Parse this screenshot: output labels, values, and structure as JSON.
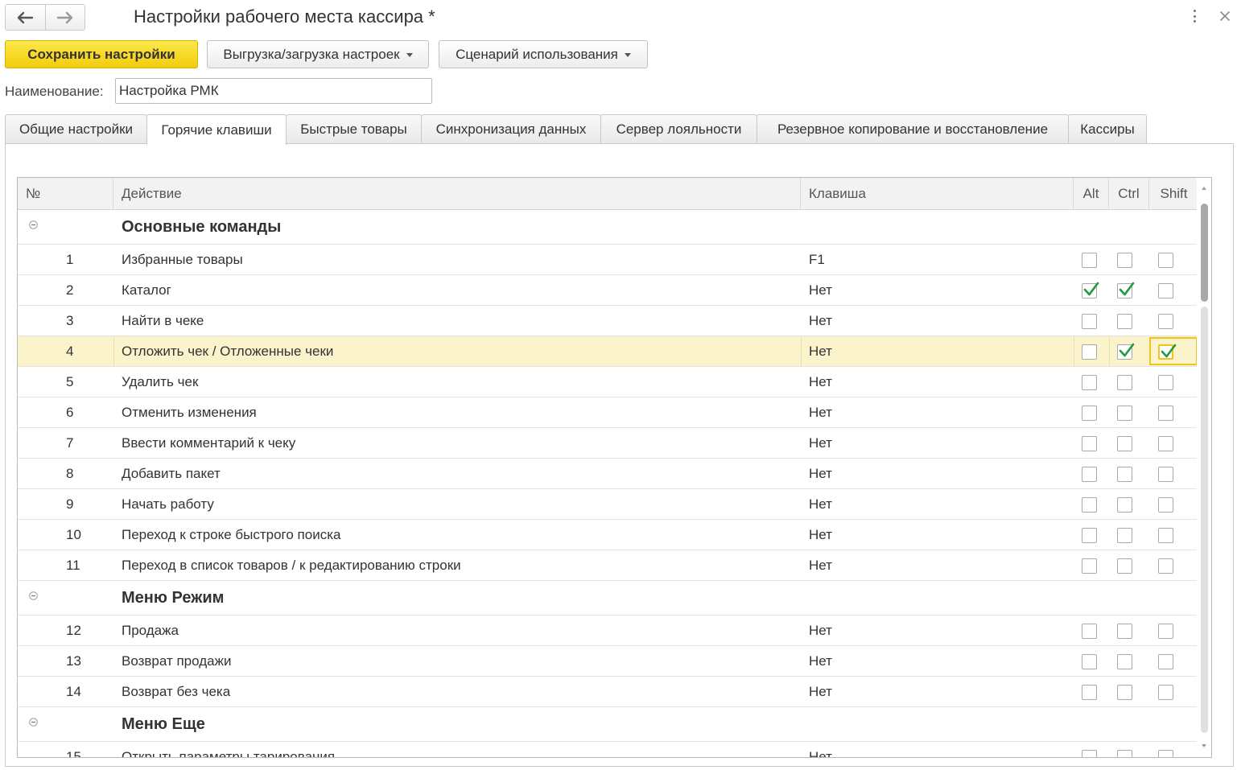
{
  "window": {
    "title": "Настройки рабочего места кассира *"
  },
  "toolbar": {
    "save_label": "Сохранить настройки",
    "export_label": "Выгрузка/загрузка настроек",
    "scenario_label": "Сценарий использования"
  },
  "form": {
    "name_label": "Наименование:",
    "name_value": "Настройка РМК"
  },
  "tabs": [
    {
      "label": "Общие настройки",
      "active": false
    },
    {
      "label": "Горячие клавиши",
      "active": true
    },
    {
      "label": "Быстрые товары",
      "active": false
    },
    {
      "label": "Синхронизация данных",
      "active": false
    },
    {
      "label": "Сервер лояльности",
      "active": false
    },
    {
      "label": "Резервное копирование и восстановление",
      "active": false
    },
    {
      "label": "Кассиры",
      "active": false
    }
  ],
  "table": {
    "columns": {
      "num": "№",
      "action": "Действие",
      "key": "Клавиша",
      "alt": "Alt",
      "ctrl": "Ctrl",
      "shift": "Shift"
    },
    "rows": [
      {
        "type": "group",
        "title": "Основные команды"
      },
      {
        "type": "item",
        "num": "1",
        "action": "Избранные товары",
        "key": "F1",
        "alt": false,
        "ctrl": false,
        "shift": false
      },
      {
        "type": "item",
        "num": "2",
        "action": "Каталог",
        "key": "Нет",
        "alt": true,
        "ctrl": true,
        "shift": false
      },
      {
        "type": "item",
        "num": "3",
        "action": "Найти в чеке",
        "key": "Нет",
        "alt": false,
        "ctrl": false,
        "shift": false
      },
      {
        "type": "item",
        "num": "4",
        "action": "Отложить чек / Отложенные чеки",
        "key": "Нет",
        "alt": false,
        "ctrl": true,
        "shift": true,
        "selected": true
      },
      {
        "type": "item",
        "num": "5",
        "action": "Удалить чек",
        "key": "Нет",
        "alt": false,
        "ctrl": false,
        "shift": false
      },
      {
        "type": "item",
        "num": "6",
        "action": "Отменить изменения",
        "key": "Нет",
        "alt": false,
        "ctrl": false,
        "shift": false
      },
      {
        "type": "item",
        "num": "7",
        "action": "Ввести комментарий к чеку",
        "key": "Нет",
        "alt": false,
        "ctrl": false,
        "shift": false
      },
      {
        "type": "item",
        "num": "8",
        "action": "Добавить пакет",
        "key": "Нет",
        "alt": false,
        "ctrl": false,
        "shift": false
      },
      {
        "type": "item",
        "num": "9",
        "action": "Начать работу",
        "key": "Нет",
        "alt": false,
        "ctrl": false,
        "shift": false
      },
      {
        "type": "item",
        "num": "10",
        "action": "Переход к строке быстрого поиска",
        "key": "Нет",
        "alt": false,
        "ctrl": false,
        "shift": false
      },
      {
        "type": "item",
        "num": "11",
        "action": "Переход в список товаров / к редактированию строки",
        "key": "Нет",
        "alt": false,
        "ctrl": false,
        "shift": false
      },
      {
        "type": "group",
        "title": "Меню Режим"
      },
      {
        "type": "item",
        "num": "12",
        "action": "Продажа",
        "key": "Нет",
        "alt": false,
        "ctrl": false,
        "shift": false
      },
      {
        "type": "item",
        "num": "13",
        "action": "Возврат продажи",
        "key": "Нет",
        "alt": false,
        "ctrl": false,
        "shift": false
      },
      {
        "type": "item",
        "num": "14",
        "action": "Возврат без чека",
        "key": "Нет",
        "alt": false,
        "ctrl": false,
        "shift": false
      },
      {
        "type": "group",
        "title": "Меню Еще"
      },
      {
        "type": "item",
        "num": "15",
        "action": "Открыть параметры тарирования",
        "key": "Нет",
        "alt": false,
        "ctrl": false,
        "shift": false
      }
    ]
  },
  "colors": {
    "accent_yellow": "#f5d21a",
    "selected_row": "#fbf3cc",
    "check_green": "#1f9a3c"
  },
  "icons": {
    "back": "arrow-left-icon",
    "forward": "arrow-right-icon",
    "more": "more-vertical-icon",
    "close": "close-icon",
    "collapse": "collapse-minus-icon",
    "check": "check-icon"
  }
}
